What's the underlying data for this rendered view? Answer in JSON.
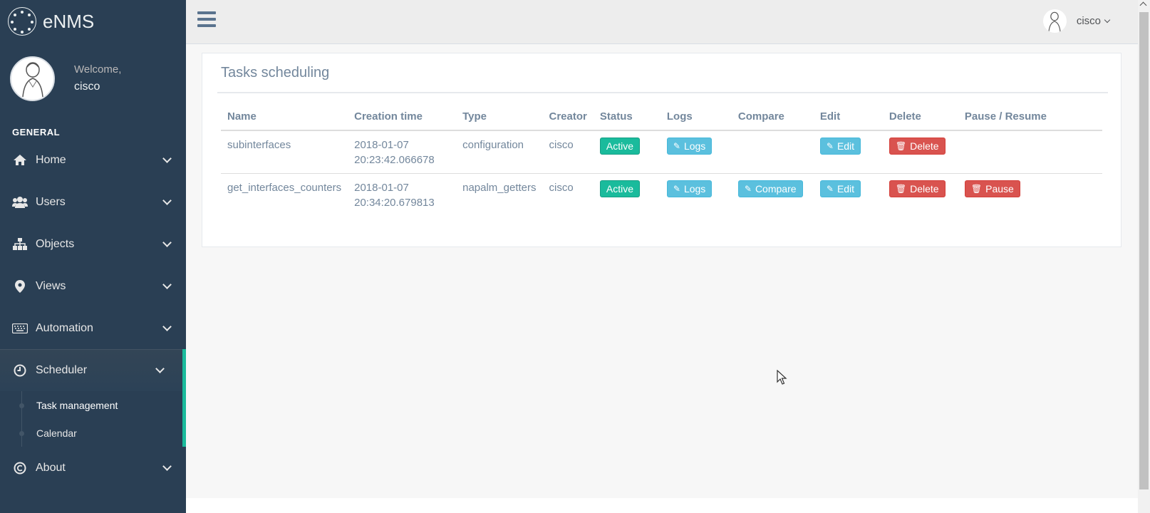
{
  "brand": {
    "name": "eNMS"
  },
  "profile": {
    "welcome": "Welcome,",
    "name": "cisco"
  },
  "sidebar": {
    "section_title": "GENERAL",
    "items": [
      {
        "label": "Home",
        "icon": "home-icon"
      },
      {
        "label": "Users",
        "icon": "users-icon"
      },
      {
        "label": "Objects",
        "icon": "sitemap-icon"
      },
      {
        "label": "Views",
        "icon": "map-marker-icon"
      },
      {
        "label": "Automation",
        "icon": "keyboard-icon"
      },
      {
        "label": "Scheduler",
        "icon": "clock-icon",
        "expanded": true,
        "children": [
          {
            "label": "Task management"
          },
          {
            "label": "Calendar"
          }
        ]
      },
      {
        "label": "About",
        "icon": "copyright-icon"
      }
    ]
  },
  "topbar": {
    "user": "cisco"
  },
  "panel": {
    "title": "Tasks scheduling",
    "columns": [
      "Name",
      "Creation time",
      "Type",
      "Creator",
      "Status",
      "Logs",
      "Compare",
      "Edit",
      "Delete",
      "Pause / Resume"
    ],
    "rows": [
      {
        "name": "subinterfaces",
        "date": "2018-01-07",
        "time": "20:23:42.066678",
        "type": "configuration",
        "creator": "cisco",
        "status": "Active",
        "logs": "Logs",
        "compare": "",
        "edit": "Edit",
        "delete": "Delete",
        "pause": ""
      },
      {
        "name": "get_interfaces_counters",
        "date": "2018-01-07",
        "time": "20:34:20.679813",
        "type": "napalm_getters",
        "creator": "cisco",
        "status": "Active",
        "logs": "Logs",
        "compare": "Compare",
        "edit": "Edit",
        "delete": "Delete",
        "pause": "Pause"
      }
    ]
  },
  "colors": {
    "sidebar": "#2a3f54",
    "accent": "#1abb9c",
    "info": "#5bc0de",
    "danger": "#d9534f"
  }
}
